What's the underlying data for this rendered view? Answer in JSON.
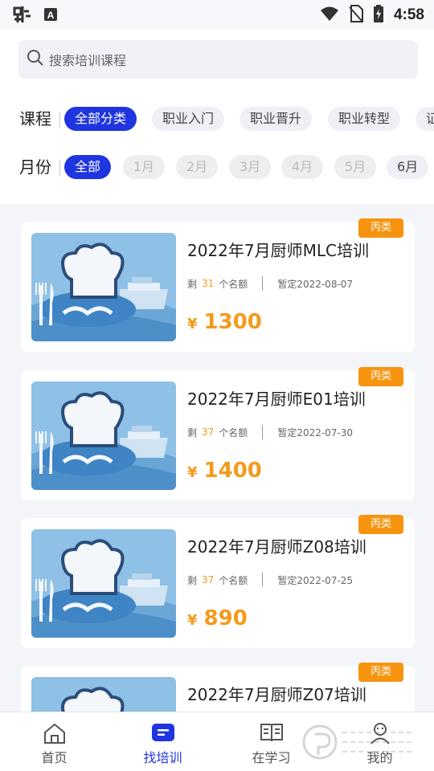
{
  "status_bar": {
    "time": "4:58"
  },
  "search": {
    "placeholder": "搜索培训课程"
  },
  "filters": {
    "course": {
      "label": "课程",
      "chips": [
        {
          "label": "全部分类",
          "state": "active"
        },
        {
          "label": "职业入门",
          "state": "normal"
        },
        {
          "label": "职业晋升",
          "state": "normal"
        },
        {
          "label": "职业转型",
          "state": "normal"
        },
        {
          "label": "证",
          "state": "normal"
        }
      ]
    },
    "month": {
      "label": "月份",
      "chips": [
        {
          "label": "全部",
          "state": "active"
        },
        {
          "label": "1月",
          "state": "disabled"
        },
        {
          "label": "2月",
          "state": "disabled"
        },
        {
          "label": "3月",
          "state": "disabled"
        },
        {
          "label": "4月",
          "state": "disabled"
        },
        {
          "label": "5月",
          "state": "disabled"
        },
        {
          "label": "6月",
          "state": "normal"
        }
      ]
    }
  },
  "courses": [
    {
      "title": "2022年7月厨师MLC培训",
      "remain_prefix": "剩",
      "remain": "31",
      "remain_suffix": "个名额",
      "date": "暂定2022-08-07",
      "currency": "¥",
      "price": "1300",
      "tag": "丙类"
    },
    {
      "title": "2022年7月厨师E01培训",
      "remain_prefix": "剩",
      "remain": "37",
      "remain_suffix": "个名额",
      "date": "暂定2022-07-30",
      "currency": "¥",
      "price": "1400",
      "tag": "丙类"
    },
    {
      "title": "2022年7月厨师Z08培训",
      "remain_prefix": "剩",
      "remain": "37",
      "remain_suffix": "个名额",
      "date": "暂定2022-07-25",
      "currency": "¥",
      "price": "890",
      "tag": "丙类"
    },
    {
      "title": "2022年7月厨师Z07培训",
      "tag": "丙类"
    }
  ],
  "bottom_nav": [
    {
      "label": "首页",
      "icon": "home-icon",
      "active": false
    },
    {
      "label": "找培训",
      "icon": "find-training-icon",
      "active": true
    },
    {
      "label": "在学习",
      "icon": "book-icon",
      "active": false
    },
    {
      "label": "我的",
      "icon": "profile-icon",
      "active": false
    }
  ],
  "colors": {
    "accent": "#1f35e0",
    "price": "#f39a1c",
    "tag": "#f7940f"
  }
}
